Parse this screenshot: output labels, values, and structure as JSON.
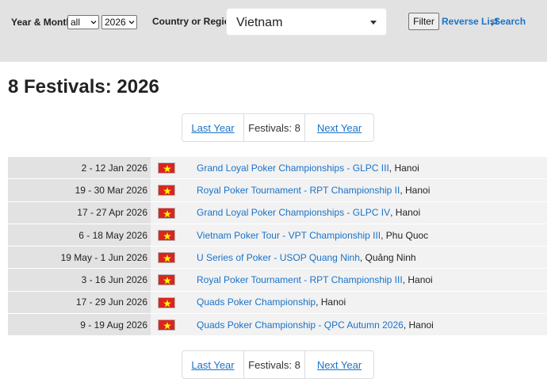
{
  "filters": {
    "year_month_label": "Year & Month",
    "month_value": "all",
    "year_value": "2026",
    "region_label": "Country or Region",
    "region_value": "Vietnam",
    "filter_button": "Filter",
    "reverse_link": "Reverse List",
    "comma": ",",
    "search_link": "Search"
  },
  "page_title": "8 Festivals: 2026",
  "pager": {
    "prev": "Last Year",
    "count": "Festivals: 8",
    "next": "Next Year"
  },
  "festivals": [
    {
      "dates": "2 - 12 Jan 2026",
      "name": "Grand Loyal Poker Championships - GLPC III",
      "location": ", Hanoi"
    },
    {
      "dates": "19 - 30 Mar 2026",
      "name": "Royal Poker Tournament - RPT Championship II",
      "location": ", Hanoi"
    },
    {
      "dates": "17 - 27 Apr 2026",
      "name": "Grand Loyal Poker Championships - GLPC IV",
      "location": ", Hanoi"
    },
    {
      "dates": "6 - 18 May 2026",
      "name": "Vietnam Poker Tour - VPT Championship III",
      "location": ", Phu Quoc"
    },
    {
      "dates": "19 May - 1 Jun 2026",
      "name": "U Series of Poker - USOP Quang Ninh",
      "location": ", Quảng Ninh"
    },
    {
      "dates": "3 - 16 Jun 2026",
      "name": "Royal Poker Tournament - RPT Championship III",
      "location": ", Hanoi"
    },
    {
      "dates": "17 - 29 Jun 2026",
      "name": "Quads Poker Championship",
      "location": ", Hanoi"
    },
    {
      "dates": "9 - 19 Aug 2026",
      "name": "Quads Poker Championship - QPC Autumn 2026",
      "location": ", Hanoi"
    }
  ],
  "flag_icon": "vietnam-flag-icon",
  "colors": {
    "link": "#1a73c8",
    "flag_red": "#da251d",
    "flag_star": "#ffff00"
  }
}
